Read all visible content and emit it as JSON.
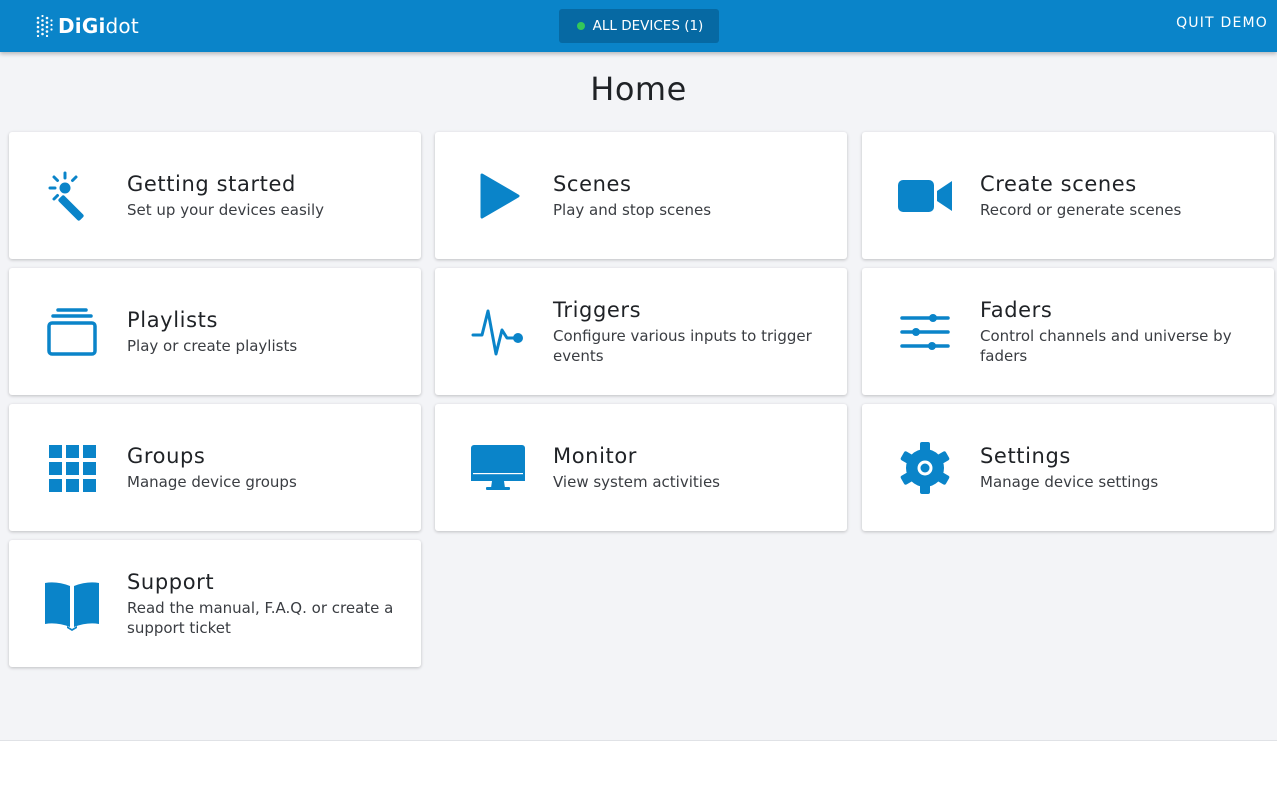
{
  "header": {
    "logo_bold": "DiGi",
    "logo_light": "dot",
    "device_button_label": "ALL DEVICES (1)",
    "quit_label": "QUIT DEMO"
  },
  "page": {
    "title": "Home"
  },
  "cards": [
    {
      "title": "Getting started",
      "desc": "Set up your devices easily",
      "icon": "magic-wand-icon"
    },
    {
      "title": "Scenes",
      "desc": "Play and stop scenes",
      "icon": "play-icon"
    },
    {
      "title": "Create scenes",
      "desc": "Record or generate scenes",
      "icon": "video-camera-icon"
    },
    {
      "title": "Playlists",
      "desc": "Play or create playlists",
      "icon": "playlist-icon"
    },
    {
      "title": "Triggers",
      "desc": "Configure various inputs to trigger events",
      "icon": "pulse-icon"
    },
    {
      "title": "Faders",
      "desc": "Control channels and universe by faders",
      "icon": "sliders-icon"
    },
    {
      "title": "Groups",
      "desc": "Manage device groups",
      "icon": "grid-icon"
    },
    {
      "title": "Monitor",
      "desc": "View system activities",
      "icon": "monitor-icon"
    },
    {
      "title": "Settings",
      "desc": "Manage device settings",
      "icon": "gear-icon"
    },
    {
      "title": "Support",
      "desc": "Read the manual, F.A.Q. or create a support ticket",
      "icon": "book-icon"
    }
  ],
  "colors": {
    "brand": "#0a84c9",
    "brand_dark": "#0669a3",
    "icon": "#0a84c9",
    "status_online": "#34c759",
    "background": "#f3f4f7"
  }
}
